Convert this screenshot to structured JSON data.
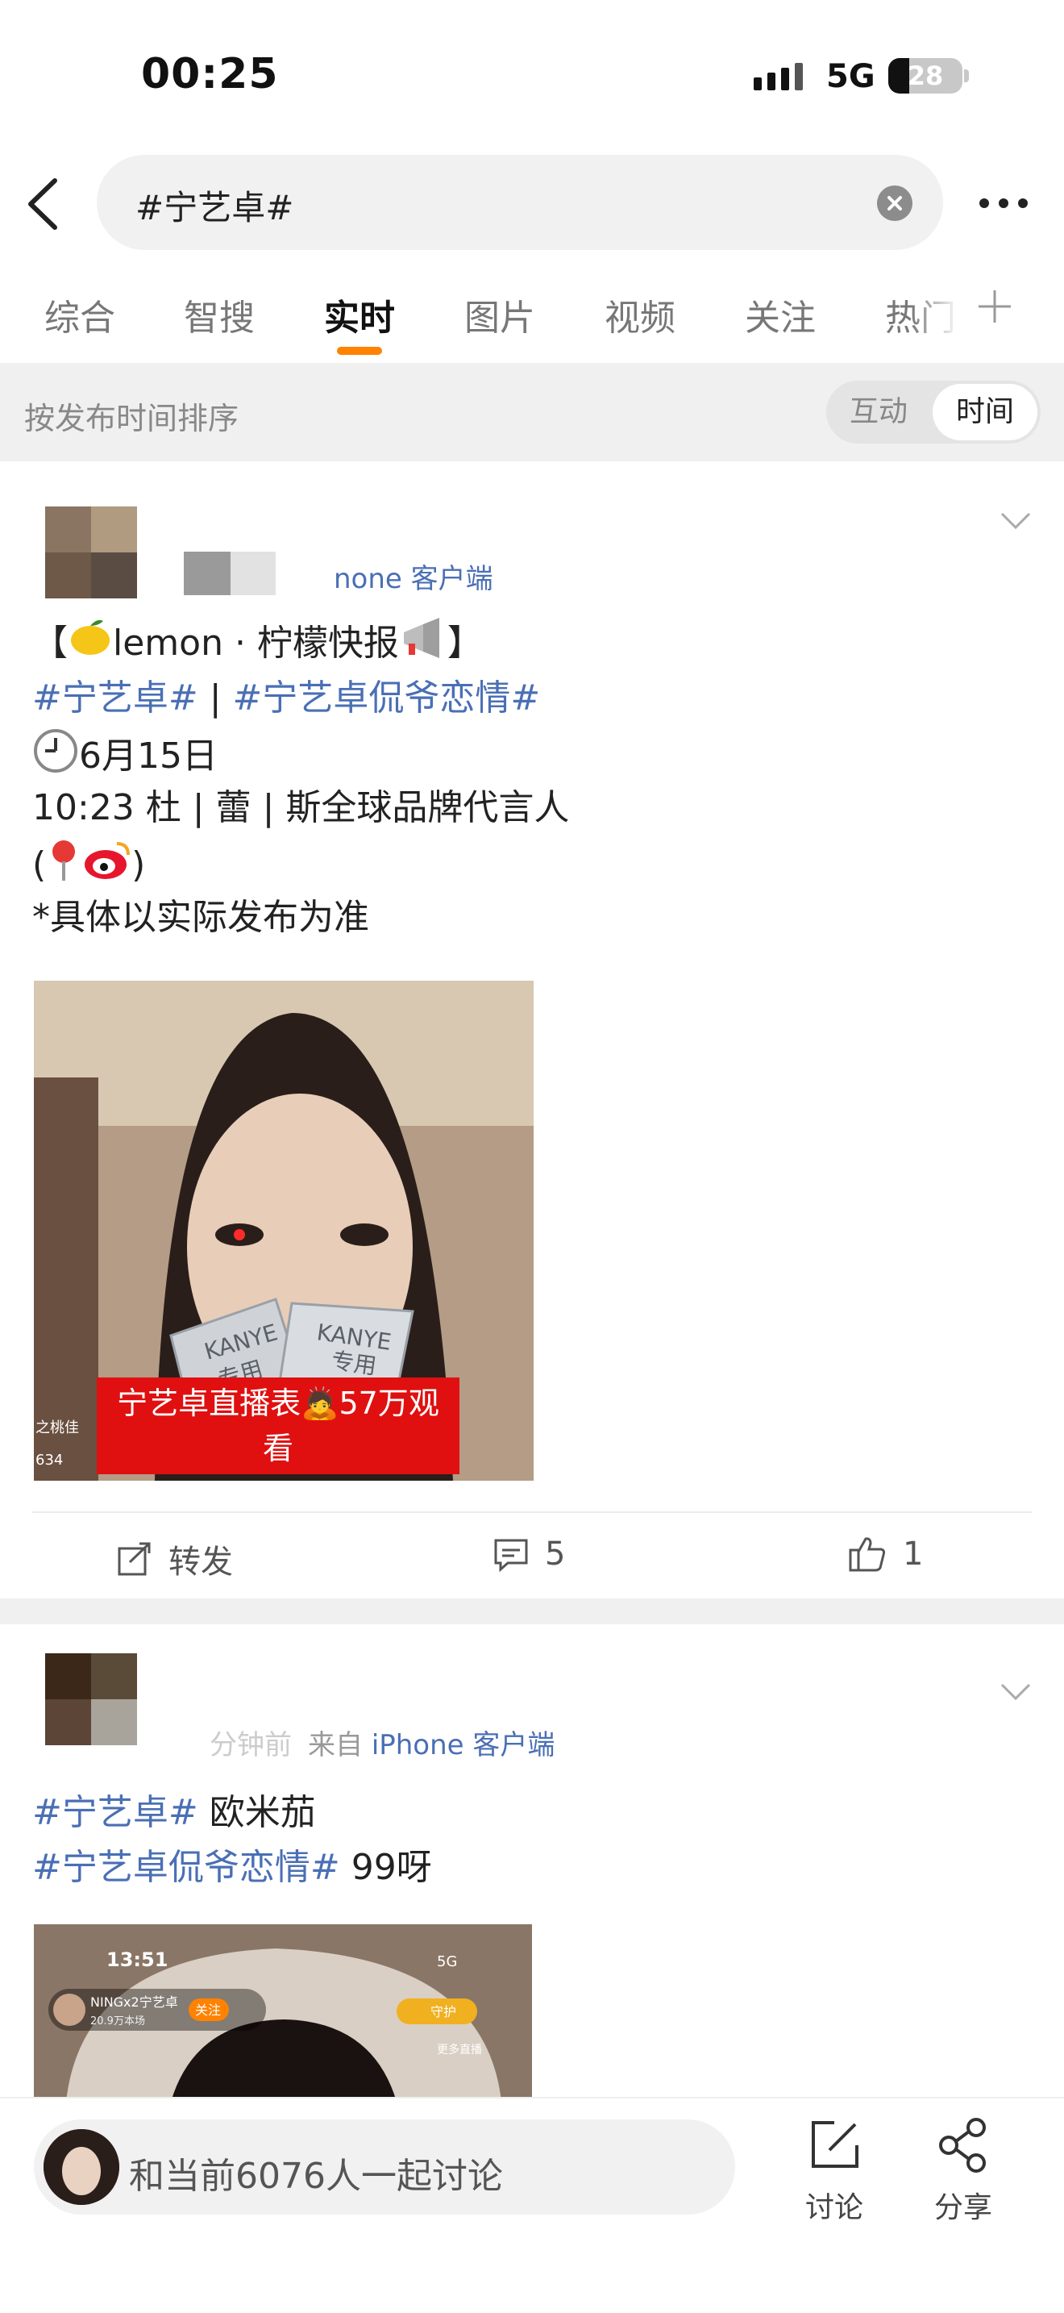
{
  "status_bar": {
    "time": "00:25",
    "network": "5G",
    "battery": "28",
    "battery_level": 0.28
  },
  "search": {
    "query": "#宁艺卓#"
  },
  "tabs": [
    {
      "label": "综合",
      "active": false
    },
    {
      "label": "智搜",
      "active": false
    },
    {
      "label": "实时",
      "active": true
    },
    {
      "label": "图片",
      "active": false
    },
    {
      "label": "视频",
      "active": false
    },
    {
      "label": "关注",
      "active": false
    },
    {
      "label": "热门",
      "active": false
    }
  ],
  "sort": {
    "label": "按发布时间排序",
    "options": [
      "互动",
      "时间"
    ],
    "selected": "时间"
  },
  "posts": [
    {
      "source_partial": "none 客户端",
      "lines": [
        {
          "parts": [
            "【",
            "lemon · 柠檬快报",
            "】"
          ]
        },
        {
          "tag1": "#宁艺卓#",
          "sep": " | ",
          "tag2": "#宁艺卓侃爷恋情#"
        },
        {
          "text": "6月15日"
        },
        {
          "text": "10:23 杜 | 蕾 | 斯全球品牌代言人"
        },
        {
          "open": "(",
          "close": ")"
        },
        {
          "text": "*具体以实际发布为准"
        }
      ],
      "image": {
        "caption": "宁艺卓直播表🙇57万观看",
        "packet_text": [
          "KANYE",
          "专用"
        ],
        "corner_text": [
          "之桃佳",
          "634"
        ]
      },
      "actions": {
        "repost": "转发",
        "comments": "5",
        "likes": "1"
      }
    },
    {
      "time_partial": "分钟前",
      "source_prefix": "来自",
      "source": "iPhone 客户端",
      "lines": [
        {
          "tag": "#宁艺卓#",
          "text": "欧米茄"
        },
        {
          "tag": "#宁艺卓侃爷恋情#",
          "text": "99呀"
        }
      ],
      "image": {
        "time": "13:51",
        "network": "5G",
        "host": "NINGx2宁艺卓",
        "host_sub": "20.9万本场",
        "follow": "关注",
        "guard": "守护",
        "more_live": "更多直播"
      }
    }
  ],
  "bottom_bar": {
    "discussion_text": "和当前6076人一起讨论",
    "discuss_label": "讨论",
    "share_label": "分享"
  },
  "colors": {
    "accent": "#ff8200",
    "link": "#4a6fb5",
    "highlight_red": "#e01010"
  }
}
